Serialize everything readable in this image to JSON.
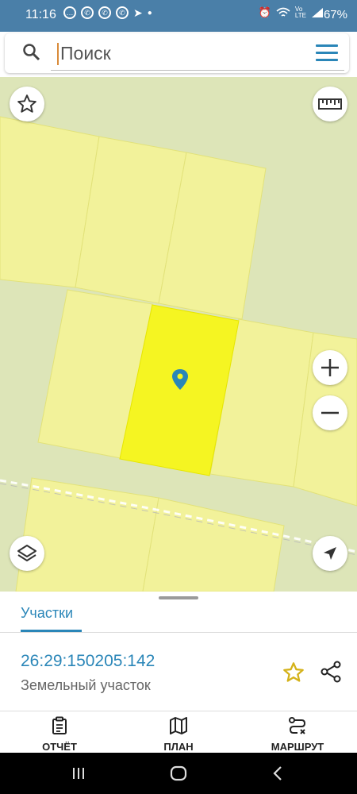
{
  "status_bar": {
    "time": "11:16",
    "battery": "67%",
    "color": "#4a7fa8"
  },
  "search": {
    "placeholder": "Поиск",
    "icons": [
      "search-icon",
      "hamburger-menu-icon"
    ]
  },
  "map": {
    "colors": {
      "background": "#dde5b8",
      "parcel": "#f2f29a",
      "selected_parcel": "#f5f522",
      "marker": "#2a86b8"
    },
    "controls": [
      "favorite-star-icon",
      "ruler-icon",
      "zoom-in-icon",
      "zoom-out-icon",
      "layers-icon",
      "navigation-arrow-icon"
    ]
  },
  "sheet": {
    "tab_label": "Участки",
    "parcel": {
      "cadastral_number": "26:29:150205:142",
      "type": "Земельный участок"
    },
    "accent": "#2a86b8",
    "star_color": "#d4b21a"
  },
  "bottom_nav": {
    "items": [
      {
        "label": "ОТЧЁТ",
        "icon": "clipboard-icon"
      },
      {
        "label": "ПЛАН",
        "icon": "map-icon"
      },
      {
        "label": "МАРШРУТ",
        "icon": "route-icon"
      }
    ]
  },
  "system_nav": {
    "icons": [
      "recent-apps-icon",
      "home-icon",
      "back-icon"
    ]
  }
}
